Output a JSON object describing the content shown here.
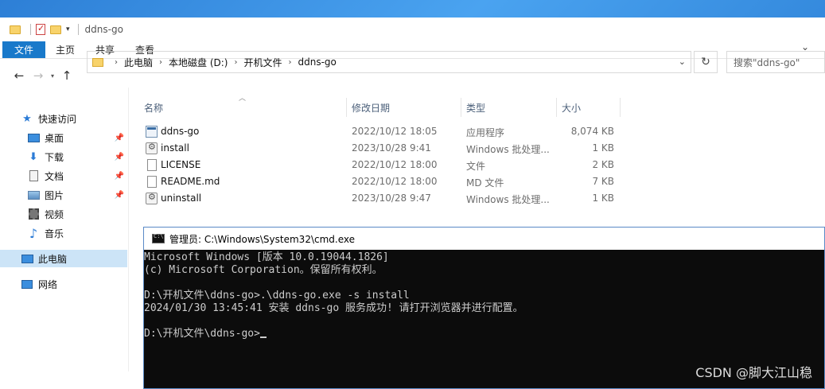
{
  "window": {
    "title": "ddns-go"
  },
  "ribbon": {
    "tabs": [
      "文件",
      "主页",
      "共享",
      "查看"
    ]
  },
  "address": {
    "crumbs": [
      "此电脑",
      "本地磁盘 (D:)",
      "开机文件",
      "ddns-go"
    ],
    "search_placeholder": "搜索\"ddns-go\""
  },
  "sidebar": {
    "items": [
      {
        "label": "快速访问",
        "icon": "star-icon",
        "pinned": false
      },
      {
        "label": "桌面",
        "icon": "desktop-icon",
        "pinned": true
      },
      {
        "label": "下载",
        "icon": "download-icon",
        "pinned": true
      },
      {
        "label": "文档",
        "icon": "document-icon",
        "pinned": true
      },
      {
        "label": "图片",
        "icon": "picture-icon",
        "pinned": true
      },
      {
        "label": "视频",
        "icon": "video-icon",
        "pinned": false
      },
      {
        "label": "音乐",
        "icon": "music-icon",
        "pinned": false
      },
      {
        "label": "此电脑",
        "icon": "computer-icon",
        "pinned": false
      },
      {
        "label": "网络",
        "icon": "network-icon",
        "pinned": false
      }
    ]
  },
  "columns": {
    "name": "名称",
    "date": "修改日期",
    "type": "类型",
    "size": "大小"
  },
  "files": [
    {
      "name": "ddns-go",
      "date": "2022/10/12 18:05",
      "type": "应用程序",
      "size": "8,074 KB",
      "icon": "exe"
    },
    {
      "name": "install",
      "date": "2023/10/28 9:41",
      "type": "Windows 批处理...",
      "size": "1 KB",
      "icon": "bat"
    },
    {
      "name": "LICENSE",
      "date": "2022/10/12 18:00",
      "type": "文件",
      "size": "2 KB",
      "icon": "doc"
    },
    {
      "name": "README.md",
      "date": "2022/10/12 18:00",
      "type": "MD 文件",
      "size": "7 KB",
      "icon": "doc"
    },
    {
      "name": "uninstall",
      "date": "2023/10/28 9:47",
      "type": "Windows 批处理...",
      "size": "1 KB",
      "icon": "bat"
    }
  ],
  "cmd": {
    "title": "管理员: C:\\Windows\\System32\\cmd.exe",
    "lines": [
      "Microsoft Windows [版本 10.0.19044.1826]",
      "(c) Microsoft Corporation。保留所有权利。",
      "",
      "D:\\开机文件\\ddns-go>.\\ddns-go.exe -s install",
      "2024/01/30 13:45:41 安装 ddns-go 服务成功! 请打开浏览器并进行配置。",
      "",
      "D:\\开机文件\\ddns-go>"
    ]
  },
  "watermark": "CSDN @脚大江山稳"
}
